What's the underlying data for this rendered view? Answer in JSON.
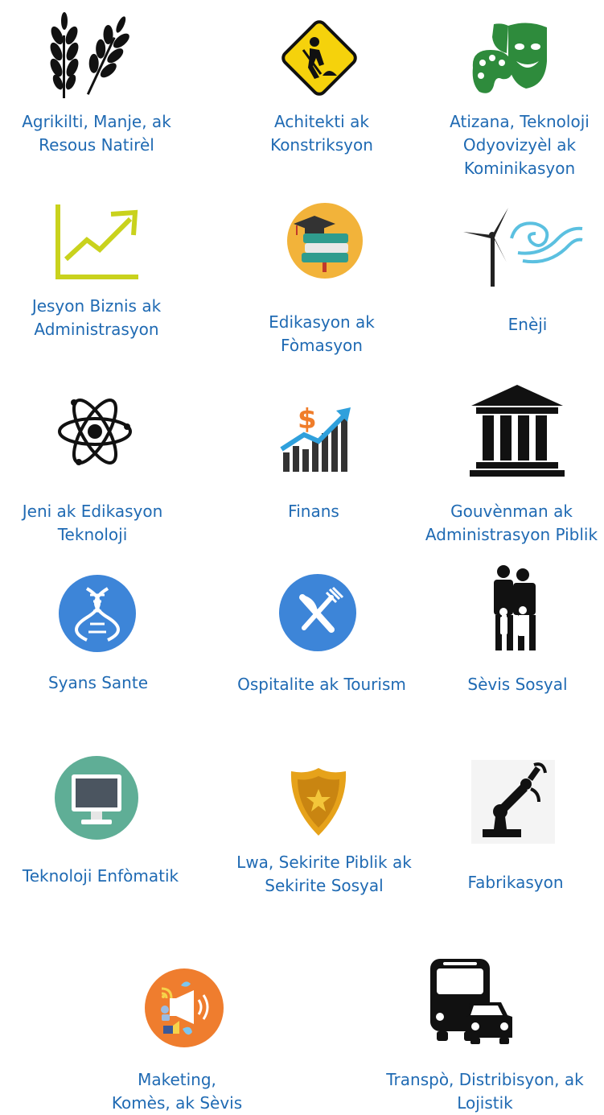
{
  "items": [
    {
      "id": "agriculture",
      "label_lines": [
        "Agrikilti, Manje, ak",
        "Resous Natirèl"
      ],
      "icon": "wheat-icon"
    },
    {
      "id": "architecture",
      "label_lines": [
        "Achitekti ak",
        "Konstriksyon"
      ],
      "icon": "construction-sign-icon"
    },
    {
      "id": "arts",
      "label_lines": [
        "Atizana, Teknoloji",
        "Odyovizyèl ak",
        "Kominikasyon"
      ],
      "icon": "theater-masks-palette-icon"
    },
    {
      "id": "business",
      "label_lines": [
        "Jesyon Biznis ak",
        "Administrasyon"
      ],
      "icon": "trend-chart-icon"
    },
    {
      "id": "education",
      "label_lines": [
        "Edikasyon ak",
        "Fòmasyon"
      ],
      "icon": "graduation-books-icon"
    },
    {
      "id": "energy",
      "label_lines": [
        "Enèji"
      ],
      "icon": "wind-turbine-wave-icon"
    },
    {
      "id": "engineering",
      "label_lines": [
        "Jeni ak Edikasyon",
        "Teknoloji"
      ],
      "icon": "atom-icon"
    },
    {
      "id": "finance",
      "label_lines": [
        "Finans"
      ],
      "icon": "dollar-growth-chart-icon"
    },
    {
      "id": "government",
      "label_lines": [
        "Gouvènman ak",
        "Administrasyon Piblik"
      ],
      "icon": "government-building-icon"
    },
    {
      "id": "health",
      "label_lines": [
        "Syans Sante"
      ],
      "icon": "dna-icon"
    },
    {
      "id": "hospitality",
      "label_lines": [
        "Ospitalite ak Tourism"
      ],
      "icon": "knife-fork-icon"
    },
    {
      "id": "human-services",
      "label_lines": [
        "Sèvis Sosyal"
      ],
      "icon": "family-icon"
    },
    {
      "id": "it",
      "label_lines": [
        "Teknoloji Enfòmatik"
      ],
      "icon": "computer-monitor-icon"
    },
    {
      "id": "law",
      "label_lines": [
        "Lwa, Sekirite Piblik ak",
        "Sekirite Sosyal"
      ],
      "icon": "police-badge-icon"
    },
    {
      "id": "manufacturing",
      "label_lines": [
        "Fabrikasyon"
      ],
      "icon": "robotic-arm-icon"
    },
    {
      "id": "marketing",
      "label_lines": [
        "Maketing,",
        "Komès, ak Sèvis"
      ],
      "icon": "megaphone-social-icon"
    },
    {
      "id": "transportation",
      "label_lines": [
        "Transpò, Distribisyon, ak",
        "Lojistik"
      ],
      "icon": "bus-car-icon"
    }
  ],
  "colors": {
    "label": "#1f6ab3",
    "wheat": "#111111",
    "sign": "#f5d20c",
    "masks": "#2e8b3c",
    "chart": "#c9d21d",
    "edu_circle": "#f2b33a",
    "atom": "#111111",
    "dna_circle": "#3d85d8",
    "fork_circle": "#3d85d8",
    "monitor_circle": "#5fae96",
    "badge": "#e6a21a",
    "marketing_circle": "#ef7d2e"
  }
}
